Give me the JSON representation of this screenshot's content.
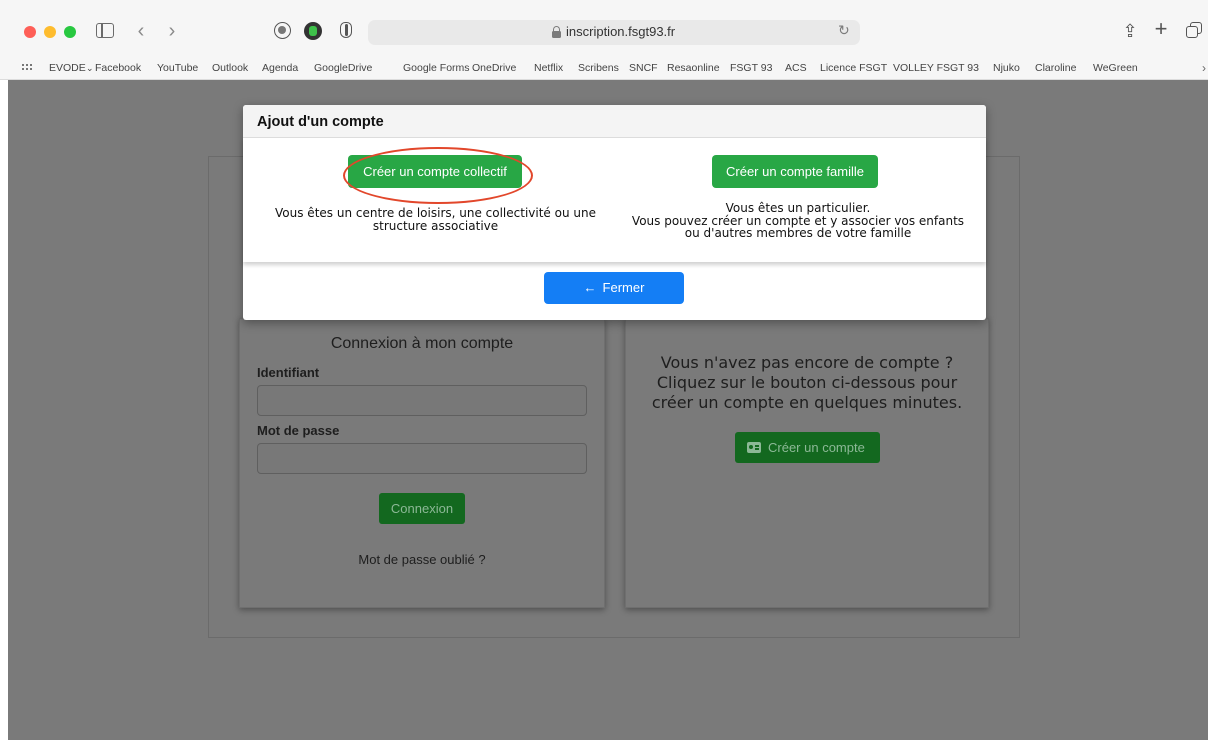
{
  "browser": {
    "url": "inscription.fsgt93.fr",
    "bookmarks": [
      "EVODE",
      "Facebook",
      "YouTube",
      "Outlook",
      "Agenda",
      "GoogleDrive",
      "Google Forms",
      "OneDrive",
      "Netflix",
      "Scribens",
      "SNCF",
      "Resaonline",
      "FSGT 93",
      "ACS",
      "Licence FSGT",
      "VOLLEY FSGT 93",
      "Njuko",
      "Claroline",
      "WeGreen"
    ],
    "bookmark_folder_chevron": "⌄"
  },
  "login": {
    "title": "Connexion à mon compte",
    "identifiant_label": "Identifiant",
    "identifiant_value": "",
    "password_label": "Mot de passe",
    "password_value": "",
    "connexion_button": "Connexion",
    "forgot_link": "Mot de passe oublié ?"
  },
  "signup": {
    "text_line1": "Vous n'avez pas encore de compte ?",
    "text_line2": "Cliquez sur le bouton ci-dessous pour",
    "text_line3": "créer un compte en quelques minutes.",
    "create_button": "Créer un compte"
  },
  "modal": {
    "title": "Ajout d'un compte",
    "collectif_button": "Créer un compte collectif",
    "collectif_desc_line1": "Vous êtes un centre de loisirs, une collectivité ou une",
    "collectif_desc_line2": "structure associative",
    "famille_button": "Créer un compte famille",
    "famille_desc_line1": "Vous êtes un particulier.",
    "famille_desc_line2": "Vous pouvez créer un compte et y associer vos enfants",
    "famille_desc_line3": "ou d'autres membres de votre famille",
    "close_button": "Fermer"
  },
  "colors": {
    "green": "#28a745",
    "blue": "#147ef5",
    "highlight": "#e2472b"
  }
}
